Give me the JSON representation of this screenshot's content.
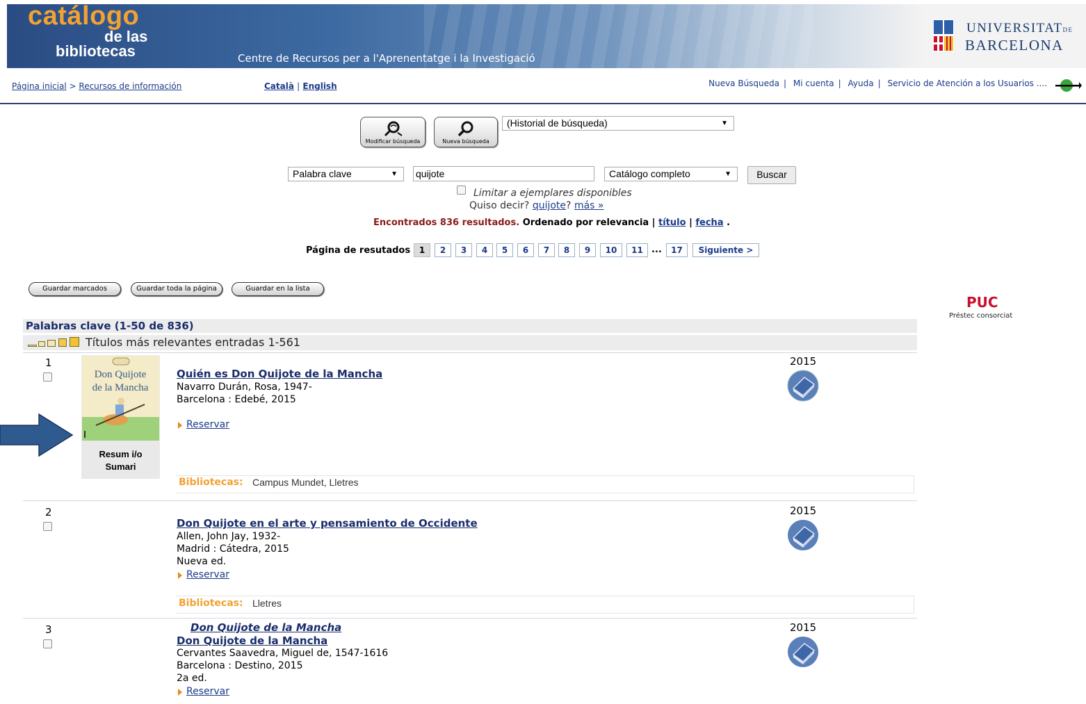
{
  "banner": {
    "logo_line1": "catálogo",
    "logo_line2": "de las",
    "logo_line3": "bibliotecas",
    "subtitle": "Centre de Recursos per a l'Aprenentatge i la Investigació",
    "ub_line1": "UNIVERSITAT",
    "ub_de": "DE",
    "ub_line2": "BARCELONA"
  },
  "nav": {
    "breadcrumb_home": "Página inicial",
    "breadcrumb_sep": ">",
    "breadcrumb_resources": "Recursos de información",
    "lang_ca": "Català",
    "lang_sep": "|",
    "lang_en": "English",
    "links": [
      "Nueva Búsqueda",
      "Mi cuenta",
      "Ayuda",
      "Servicio de Atención a los Usuarios"
    ],
    "sac_dots": "...."
  },
  "search": {
    "modify_label": "Modificar búsqueda",
    "new_label": "Nueva búsqueda",
    "history_select": "(Historial de búsqueda)",
    "field_select": "Palabra clave",
    "query": "quijote",
    "scope_select": "Catálogo completo",
    "search_button": "Buscar",
    "limit_label": "Limitar a ejemplares disponibles",
    "didyoumean_prefix": "Quiso decir?",
    "didyoumean_link": "quijote",
    "didyoumean_q": "?",
    "more_link": "más »",
    "found_text": "Encontrados 836 resultados.",
    "sorted_text": "Ordenado por relevancia |",
    "sort_title": "título",
    "sort_sep": "|",
    "sort_date": "fecha",
    "sort_end": "."
  },
  "pager": {
    "label": "Página de resutados",
    "pages": [
      "1",
      "2",
      "3",
      "4",
      "5",
      "6",
      "7",
      "8",
      "9",
      "10",
      "11"
    ],
    "current": "1",
    "dots": "...",
    "last": "17",
    "next": "Siguiente >"
  },
  "actions": {
    "save_marked": "Guardar marcados",
    "save_page": "Guardar toda la página",
    "save_list": "Guardar en la lista"
  },
  "puc": {
    "logo": "PUC",
    "sub": "Préstec consorciat"
  },
  "results_header": {
    "title": "Palabras clave (1-50 de 836)",
    "relevance": "Títulos más relevantes entradas 1-561"
  },
  "results": [
    {
      "num": "1",
      "title": "Quién es Don Quijote de la Mancha",
      "author": "Navarro Durán, Rosa, 1947-",
      "pub": "Barcelona : Edebé, 2015",
      "reserve": "Reservar",
      "year": "2015",
      "libs_label": "Bibliotecas:",
      "libs": "Campus Mundet, Lletres",
      "cover_title1": "Don Quijote",
      "cover_title2": "de la Mancha",
      "cover_cap1": "Resum i/o",
      "cover_cap2": "Sumari"
    },
    {
      "num": "2",
      "title": "Don Quijote en el arte y pensamiento de Occidente",
      "author": "Allen, John Jay, 1932-",
      "pub": "Madrid : Cátedra, 2015",
      "edition": "Nueva ed.",
      "reserve": "Reservar",
      "year": "2015",
      "libs_label": "Bibliotecas:",
      "libs": "Lletres"
    },
    {
      "num": "3",
      "series": "Don Quijote de la Mancha",
      "title": "Don Quijote de la Mancha",
      "author": "Cervantes Saavedra, Miguel de, 1547-1616",
      "pub": "Barcelona : Destino, 2015",
      "edition": "2a ed.",
      "reserve": "Reservar",
      "year": "2015"
    }
  ],
  "colors": {
    "brand_blue": "#1a2d6b",
    "orange": "#f2a233",
    "puc_red": "#c8102e",
    "arrow_blue": "#2f5a8f"
  }
}
